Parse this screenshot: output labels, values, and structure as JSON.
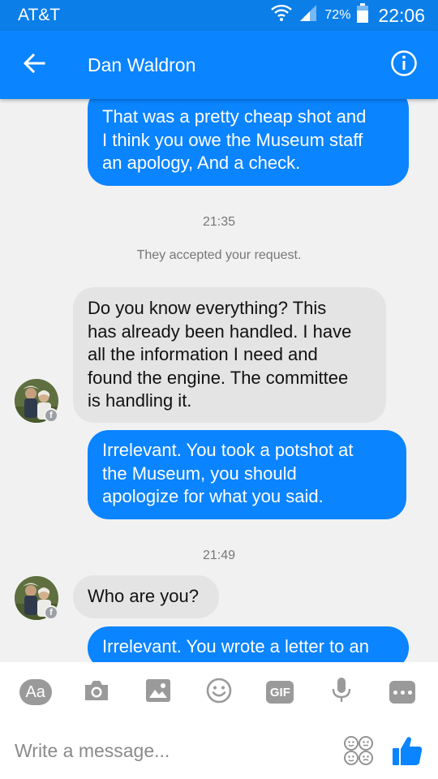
{
  "status_bar": {
    "carrier": "AT&T",
    "battery_percent": "72%",
    "time": "22:06"
  },
  "header": {
    "title": "Dan Waldron",
    "back_icon": "arrow-left-icon",
    "info_icon": "info-icon"
  },
  "messages": [
    {
      "type": "outgoing",
      "text": "That was a pretty cheap shot and\nI think you owe the Museum staff\nan apology, And a check."
    },
    {
      "type": "timestamp",
      "text": "21:35"
    },
    {
      "type": "system",
      "text": "They accepted your request."
    },
    {
      "type": "incoming",
      "text": "Do you know everything? This\nhas already been handled. I have\nall the information I need and\nfound the engine. The committee\nis handling it."
    },
    {
      "type": "outgoing",
      "text": "Irrelevant. You took a potshot at\nthe Museum, you should\napologize for what you said."
    },
    {
      "type": "timestamp",
      "text": "21:49"
    },
    {
      "type": "incoming",
      "text": "Who are you?"
    },
    {
      "type": "outgoing",
      "text": "Irrelevant. You wrote a letter to an"
    }
  ],
  "toolbar": {
    "aa_label": "Aa",
    "gif_label": "GIF",
    "icons": [
      "text-format-icon",
      "camera-icon",
      "image-icon",
      "emoji-icon",
      "gif-icon",
      "microphone-icon",
      "more-icon"
    ]
  },
  "composer": {
    "placeholder": "Write a message...",
    "value": ""
  },
  "colors": {
    "accent": "#0a84ff",
    "status_bar": "#0b7ee7",
    "incoming_bubble": "#e4e4e4",
    "background": "#f1f1f1"
  }
}
